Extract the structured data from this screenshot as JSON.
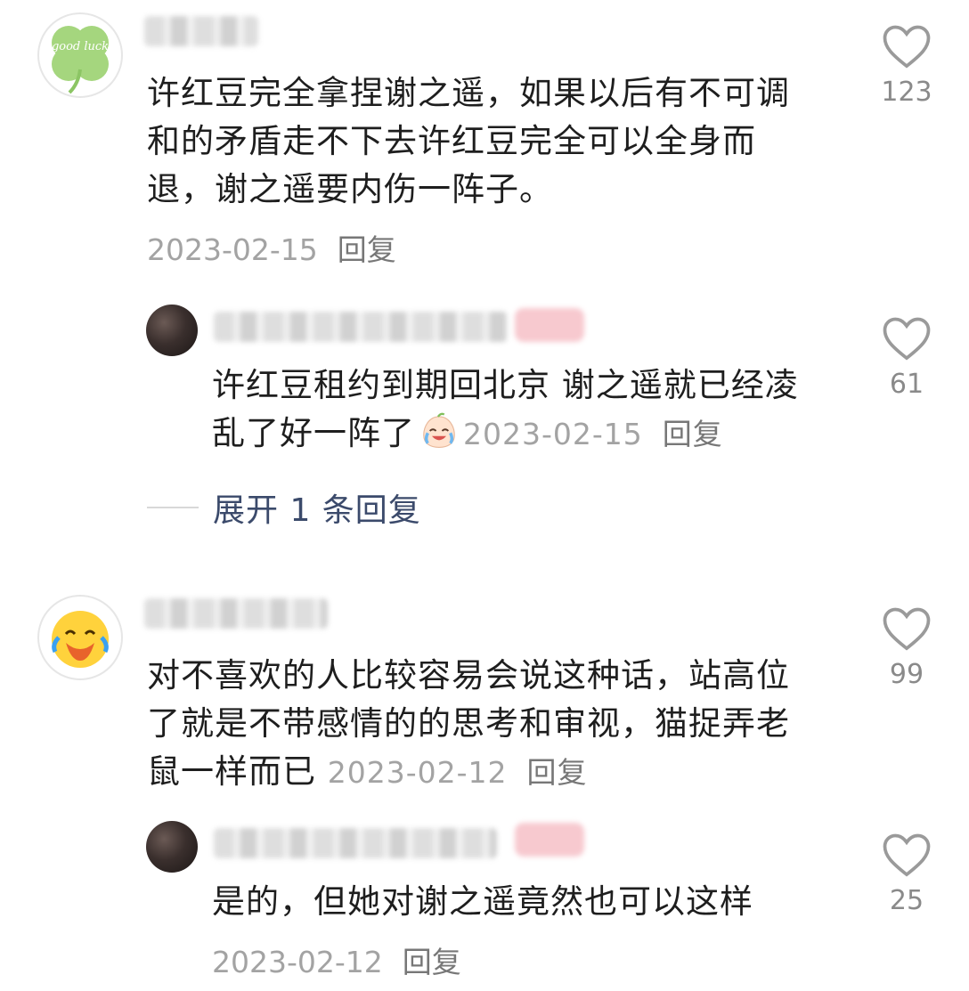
{
  "comments": [
    {
      "text_lines": [
        "许红豆完全拿捏谢之遥，如果以后有不可调",
        "和的矛盾走不下去许红豆完全可以全身而",
        "退，谢之遥要内伤一阵子。"
      ],
      "date": "2023-02-15",
      "reply_label": "回复",
      "likes": "123",
      "avatar_text": "good luck",
      "replies": [
        {
          "text_lines": [
            "许红豆租约到期回北京 谢之遥就已经凌",
            "乱了好一阵了"
          ],
          "date": "2023-02-15",
          "reply_label": "回复",
          "likes": "61"
        }
      ],
      "expand_label": "展开 1 条回复"
    },
    {
      "text_lines": [
        "对不喜欢的人比较容易会说这种话，站高位",
        "了就是不带感情的的思考和审视，猫捉弄老",
        "鼠一样而已"
      ],
      "date": "2023-02-12",
      "reply_label": "回复",
      "likes": "99",
      "replies": [
        {
          "text_lines": [
            "是的，但她对谢之遥竟然也可以这样"
          ],
          "date": "2023-02-12",
          "reply_label": "回复",
          "likes": "25"
        }
      ]
    }
  ],
  "icons": {
    "like": "heart-outline-icon",
    "emoji_crying_laugh": "crying-laugh-emoji-icon",
    "avatar_duck": "laughing-emoji-avatar-icon"
  },
  "colors": {
    "text": "#1e1e1e",
    "meta": "#a3a3a3",
    "expand": "#3b4a6b",
    "clover": "#9fd27a"
  }
}
